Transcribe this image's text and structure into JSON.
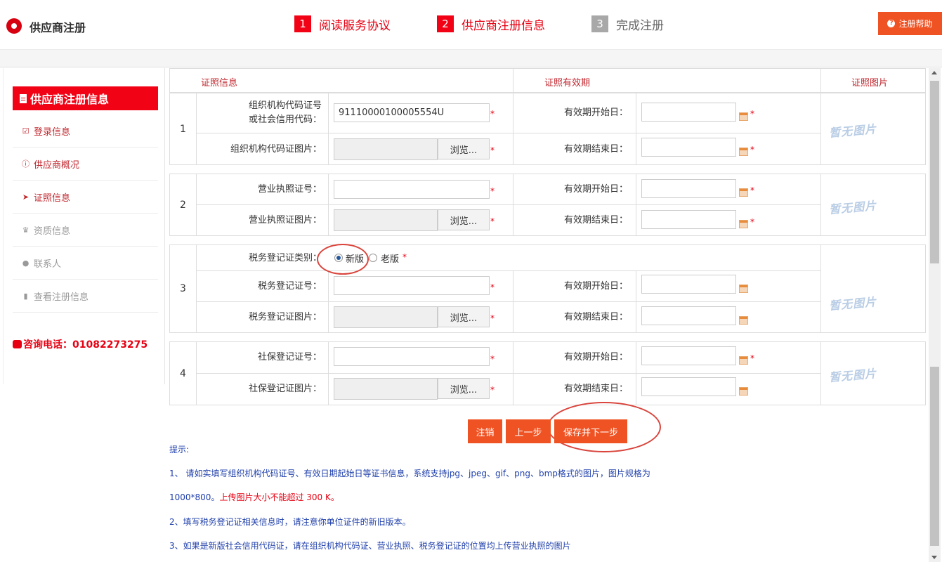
{
  "header": {
    "title": "供应商注册",
    "steps": [
      {
        "num": "1",
        "label": "阅读服务协议"
      },
      {
        "num": "2",
        "label": "供应商注册信息"
      },
      {
        "num": "3",
        "label": "完成注册"
      }
    ],
    "help_label": "注册帮助"
  },
  "sidebar": {
    "title": "供应商注册信息",
    "items": [
      {
        "label": "登录信息",
        "icon": "check-square-icon"
      },
      {
        "label": "供应商概况",
        "icon": "info-circle-icon"
      },
      {
        "label": "证照信息",
        "icon": "paper-plane-icon"
      },
      {
        "label": "资质信息",
        "icon": "trophy-icon"
      },
      {
        "label": "联系人",
        "icon": "user-icon"
      },
      {
        "label": "查看注册信息",
        "icon": "bookmark-icon"
      }
    ],
    "phone": "咨询电话：01082273275"
  },
  "table": {
    "headers": [
      "证照信息",
      "证照有效期",
      "证照图片"
    ],
    "no_image": "暂无图片",
    "browse": "浏览...",
    "start_label": "有效期开始日：",
    "end_label": "有效期结束日：",
    "groups": [
      {
        "index": "1",
        "field1_label_a": "组织机构代码证号",
        "field1_label_b": "或社会信用代码：",
        "field1_value": "91110000100005554U",
        "field2_label": "组织机构代码证图片："
      },
      {
        "index": "2",
        "field1_label": "营业执照证号：",
        "field2_label": "营业执照证图片："
      },
      {
        "index": "3",
        "type_label": "税务登记证类别：",
        "type_options": [
          "新版",
          "老版"
        ],
        "field1_label": "税务登记证号：",
        "field2_label": "税务登记证图片："
      },
      {
        "index": "4",
        "field1_label": "社保登记证号：",
        "field2_label": "社保登记证图片："
      }
    ],
    "required_mark": "*"
  },
  "buttons": {
    "cancel": "注销",
    "prev": "上一步",
    "save_next": "保存并下一步"
  },
  "tips": {
    "title": "提示:",
    "line1": "1、 请如实填写组织机构代码证号、有效日期起始日等证书信息，系统支持jpg、jpeg、gif、png、bmp格式的图片，图片规格为",
    "line1b_a": "1000*800。",
    "line1b_b": "上传图片大小不能超过 300 K。",
    "line2": "2、填写税务登记证相关信息时，请注意你单位证件的新旧版本。",
    "line3": "3、如果是新版社会信用代码证，请在组织机构代码证、营业执照、税务登记证的位置均上传营业执照的图片"
  },
  "colors": {
    "accent": "#f10215",
    "button": "#f05323",
    "tip_text": "#1f3faa"
  }
}
